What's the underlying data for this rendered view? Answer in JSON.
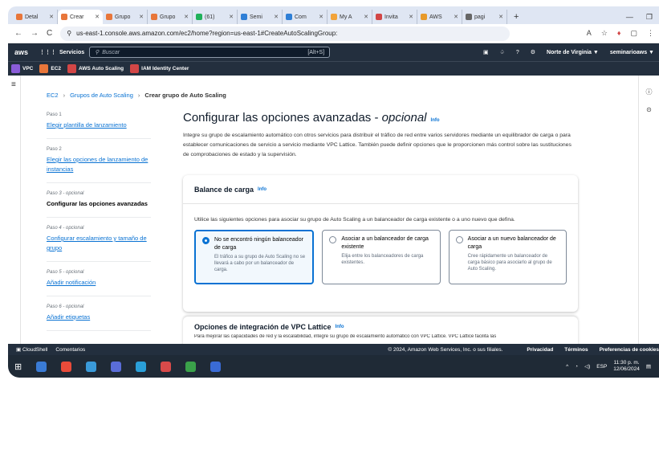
{
  "browser": {
    "tabs": [
      {
        "label": "Detal",
        "color": "#e8763a",
        "active": false
      },
      {
        "label": "Crear",
        "color": "#e8763a",
        "active": true
      },
      {
        "label": "Grupo",
        "color": "#e8763a",
        "active": false
      },
      {
        "label": "Grupo",
        "color": "#e8763a",
        "active": false
      },
      {
        "label": "(61)",
        "color": "#20b15a",
        "active": false
      },
      {
        "label": "Semi",
        "color": "#2f7fd6",
        "active": false
      },
      {
        "label": "Com",
        "color": "#2f7fd6",
        "active": false
      },
      {
        "label": "My A",
        "color": "#f2a33a",
        "active": false
      },
      {
        "label": "Invita",
        "color": "#d24646",
        "active": false
      },
      {
        "label": "AWS",
        "color": "#e89a2a",
        "active": false
      },
      {
        "label": "pagi",
        "color": "#666666",
        "active": false
      }
    ],
    "new_tab": "+",
    "url": "us-east-1.console.aws.amazon.com/ec2/home?region=us-east-1#CreateAutoScalingGroup:"
  },
  "aws_nav": {
    "logo": "aws",
    "services": "Servicios",
    "search_placeholder": "Buscar",
    "search_shortcut": "[Alt+S]",
    "region": "Norte de Virginia ▼",
    "account": "seminarioaws ▼"
  },
  "favorites": [
    {
      "label": "VPC",
      "color": "#8a5cd8"
    },
    {
      "label": "EC2",
      "color": "#e8763a"
    },
    {
      "label": "AWS Auto Scaling",
      "color": "#d24646"
    },
    {
      "label": "IAM Identity Center",
      "color": "#d24646"
    }
  ],
  "breadcrumb": {
    "item1": "EC2",
    "item2": "Grupos de Auto Scaling",
    "current": "Crear grupo de Auto Scaling"
  },
  "steps": [
    {
      "label": "Paso 1",
      "name": "Elegir plantilla de lanzamiento",
      "current": false
    },
    {
      "label": "Paso 2",
      "name": "Elegir las opciones de lanzamiento de instancias",
      "current": false
    },
    {
      "label": "Paso 3 - opcional",
      "name": "Configurar las opciones avanzadas",
      "current": true
    },
    {
      "label": "Paso 4 - opcional",
      "name": "Configurar escalamiento y tamaño de grupo",
      "current": false
    },
    {
      "label": "Paso 5 - opcional",
      "name": "Añadir notificación",
      "current": false
    },
    {
      "label": "Paso 6 - opcional",
      "name": "Añadir etiquetas",
      "current": false
    }
  ],
  "page": {
    "title": "Configurar las opciones avanzadas - ",
    "title_optional": "opcional",
    "info": "Info",
    "description": "Integre su grupo de escalamiento automático con otros servicios para distribuir el tráfico de red entre varios servidores mediante un equilibrador de carga o para establecer comunicaciones de servicio a servicio mediante VPC Lattice. También puede definir opciones que le proporcionen más control sobre las sustituciones de comprobaciones de estado y la supervisión."
  },
  "load_balancing": {
    "title": "Balance de carga",
    "info": "Info",
    "description": "Utilice las siguientes opciones para asociar su grupo de Auto Scaling a un balanceador de carga existente o a uno nuevo que defina.",
    "options": [
      {
        "title": "No se encontró ningún balanceador de carga",
        "sub": "El tráfico a su grupo de Auto Scaling no se llevará a cabo por un balanceador de carga.",
        "selected": true
      },
      {
        "title": "Asociar a un balanceador de carga existente",
        "sub": "Elija entre los balanceadores de carga existentes.",
        "selected": false
      },
      {
        "title": "Asociar a un nuevo balanceador de carga",
        "sub": "Cree rápidamente un balanceador de carga básico para asociarlo al grupo de Auto Scaling.",
        "selected": false
      }
    ]
  },
  "vpc_lattice": {
    "title": "Opciones de integración de VPC Lattice",
    "info": "Info",
    "description": "Para mejorar las capacidades de red y la escalabilidad, integre su grupo de escalamiento automático con VPC Lattice. VPC Lattice facilita las"
  },
  "footer": {
    "cloudshell": "CloudShell",
    "comments": "Comentarios",
    "copyright": "© 2024, Amazon Web Services, Inc. o sus filiales.",
    "privacy": "Privacidad",
    "terms": "Términos",
    "cookies": "Preferencias de cookies"
  },
  "taskbar": {
    "apps": [
      "#3a7bd5",
      "#e84b3a",
      "#3a9ad9",
      "#5a6dd8",
      "#2a9fd8",
      "#d84a4a",
      "#3aa14a",
      "#3a6bd5"
    ],
    "lang": "ESP",
    "time": "11:30 p. m.",
    "date": "12/06/2024"
  }
}
